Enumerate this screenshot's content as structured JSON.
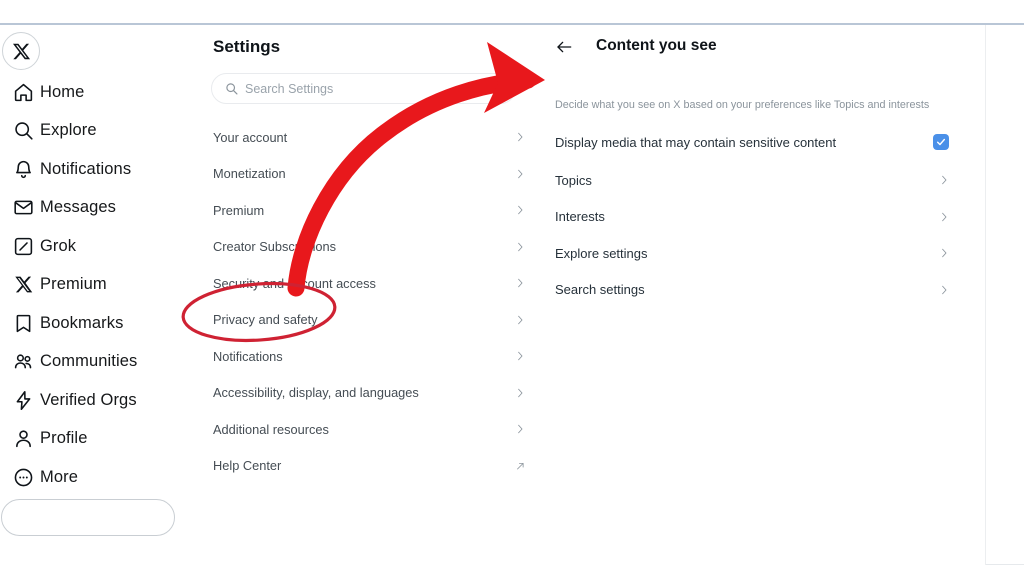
{
  "nav": {
    "logo_icon": "x-logo-icon",
    "items": [
      {
        "label": "Home",
        "icon": "home-icon"
      },
      {
        "label": "Explore",
        "icon": "search-icon"
      },
      {
        "label": "Notifications",
        "icon": "bell-icon"
      },
      {
        "label": "Messages",
        "icon": "envelope-icon"
      },
      {
        "label": "Grok",
        "icon": "grok-icon"
      },
      {
        "label": "Premium",
        "icon": "x-icon"
      },
      {
        "label": "Bookmarks",
        "icon": "bookmark-icon"
      },
      {
        "label": "Communities",
        "icon": "people-icon"
      },
      {
        "label": "Verified Orgs",
        "icon": "lightning-badge-icon"
      },
      {
        "label": "Profile",
        "icon": "person-icon"
      },
      {
        "label": "More",
        "icon": "ellipsis-circle-icon"
      }
    ],
    "post_button_label": ""
  },
  "settings": {
    "title": "Settings",
    "search": {
      "placeholder": "Search Settings",
      "value": "",
      "icon": "search-icon"
    },
    "items": [
      {
        "label": "Your account",
        "accessory": "chevron-right-icon"
      },
      {
        "label": "Monetization",
        "accessory": "chevron-right-icon"
      },
      {
        "label": "Premium",
        "accessory": "chevron-right-icon"
      },
      {
        "label": "Creator Subscriptions",
        "accessory": "chevron-right-icon"
      },
      {
        "label": "Security and account access",
        "accessory": "chevron-right-icon"
      },
      {
        "label": "Privacy and safety",
        "accessory": "chevron-right-icon"
      },
      {
        "label": "Notifications",
        "accessory": "chevron-right-icon"
      },
      {
        "label": "Accessibility, display, and languages",
        "accessory": "chevron-right-icon"
      },
      {
        "label": "Additional resources",
        "accessory": "chevron-right-icon"
      },
      {
        "label": "Help Center",
        "accessory": "external-link-icon"
      }
    ]
  },
  "detail": {
    "back_icon": "arrow-left-icon",
    "title": "Content you see",
    "subtitle": "Decide what you see on X based on your preferences like Topics and interests",
    "sensitive": {
      "label": "Display media that may contain sensitive content",
      "checked": true,
      "checkbox_color": "#4a90e8",
      "check_icon": "check-icon"
    },
    "rows": [
      {
        "label": "Topics",
        "accessory": "chevron-right-icon"
      },
      {
        "label": "Interests",
        "accessory": "chevron-right-icon"
      },
      {
        "label": "Explore settings",
        "accessory": "chevron-right-icon"
      },
      {
        "label": "Search settings",
        "accessory": "chevron-right-icon"
      }
    ]
  },
  "annotations": {
    "color": "#e8181c",
    "arrow": {
      "name": "red-curved-arrow",
      "points_to": "Content you see panel"
    },
    "ellipse": {
      "name": "red-ellipse-highlight",
      "encircles": "Privacy and safety"
    }
  }
}
